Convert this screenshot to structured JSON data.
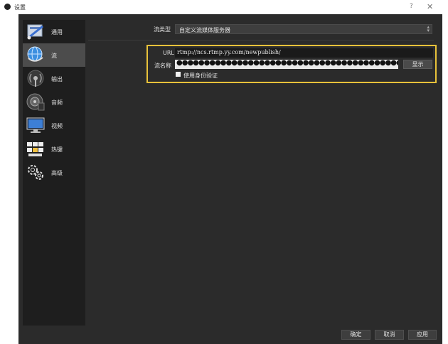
{
  "window": {
    "title": "设置"
  },
  "sidebar": {
    "items": [
      {
        "label": "通用",
        "icon": "general-icon"
      },
      {
        "label": "流",
        "icon": "globe-icon",
        "selected": true
      },
      {
        "label": "输出",
        "icon": "output-antenna-icon"
      },
      {
        "label": "音频",
        "icon": "audio-speaker-icon"
      },
      {
        "label": "视频",
        "icon": "video-monitor-icon"
      },
      {
        "label": "热键",
        "icon": "hotkeys-keyboard-icon"
      },
      {
        "label": "高级",
        "icon": "advanced-gears-icon"
      }
    ]
  },
  "stream": {
    "type_label": "流类型",
    "type_value": "自定义流媒体服务器",
    "url_label": "URL",
    "url_value": "rtmp://ncs.rtmp.yy.com/newpublish/",
    "key_label": "流名称",
    "key_value": "●●●●●●●●●●●●●●●●●●●●●●●●●●●●●●●●●●●●●●●●●",
    "show_button": "显示",
    "auth_label": "使用身份验证",
    "auth_checked": false
  },
  "footer": {
    "ok": "确定",
    "cancel": "取消",
    "apply": "应用"
  },
  "colors": {
    "highlight": "#e8c23a",
    "background": "#2b2b2b",
    "sidebar": "#1e1e1e"
  }
}
